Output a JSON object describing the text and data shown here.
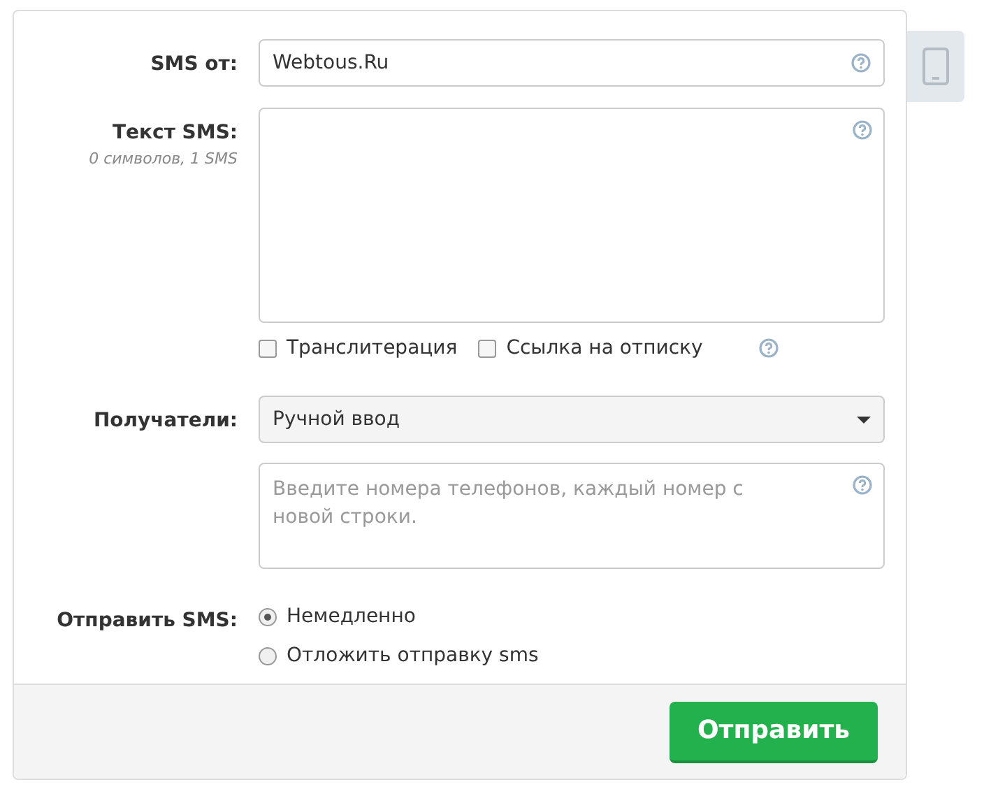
{
  "sender": {
    "label": "SMS от:",
    "value": "Webtous.Ru"
  },
  "text": {
    "label": "Текст SMS:",
    "counter": "0 символов, 1 SMS"
  },
  "options": [
    {
      "label": "Транслитерация",
      "checked": false
    },
    {
      "label": "Ссылка на отписку",
      "checked": false
    }
  ],
  "recipients": {
    "label": "Получатели:",
    "value": "Ручной ввод",
    "placeholder": "Введите номера телефонов, каждый номер с новой строки."
  },
  "send_mode": {
    "label": "Отправить SMS:",
    "options": [
      {
        "label": "Немедленно",
        "selected": true
      },
      {
        "label": "Отложить отправку sms",
        "selected": false
      }
    ]
  },
  "submit": "Отправить"
}
